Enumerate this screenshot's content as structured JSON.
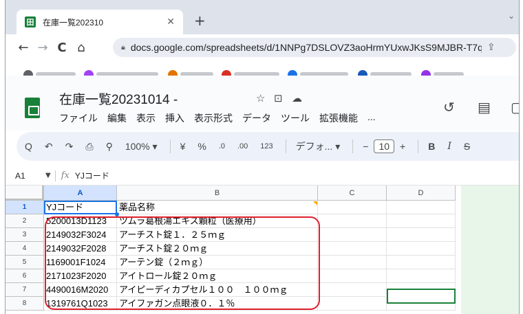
{
  "browser": {
    "tab_title": "在庫一覧202310",
    "tab_favicon_letter": "田",
    "tab_close": "✕",
    "new_tab": "+",
    "url": "docs.google.com/spreadsheets/d/1NNPg7DSLOVZ3aoHrmYUxwJKsS9MJBR-T7q...",
    "nav": {
      "back": "←",
      "forward": "→",
      "reload": "C",
      "home": "⌂"
    }
  },
  "doc": {
    "title": "在庫一覧20231014 -",
    "star_icon": "☆",
    "move_icon": "⊡",
    "cloud_icon": "☁",
    "menu": [
      "ファイル",
      "編集",
      "表示",
      "挿入",
      "表示形式",
      "データ",
      "ツール",
      "拡張機能",
      "..."
    ],
    "history_icon": "↺",
    "comment_icon": "▤"
  },
  "format_toolbar": {
    "search": "Q",
    "undo": "↶",
    "redo": "↷",
    "print": "⎙",
    "paint": "⚲",
    "zoom": "100%",
    "zoom_arrow": "▾",
    "currency": "¥",
    "percent": "%",
    "dec_decrease": ".0",
    "dec_increase": ".00",
    "number_format": "123",
    "font": "デフォ...",
    "font_arrow": "▾",
    "minus": "−",
    "font_size": "10",
    "plus": "+",
    "bold": "B",
    "italic": "I",
    "strike": "S"
  },
  "formula_bar": {
    "name_box": "A1",
    "fx": "fx",
    "content": "YJコード"
  },
  "grid": {
    "columns": [
      "A",
      "B",
      "C",
      "D"
    ],
    "rows": [
      {
        "num": "1",
        "a": "YJコード",
        "b": "薬品名称"
      },
      {
        "num": "2",
        "a": "5200013D1123",
        "b": "ツムラ葛根湯エキス顆粒（医療用）"
      },
      {
        "num": "3",
        "a": "2149032F3024",
        "b": "アーチスト錠１．２５ｍｇ"
      },
      {
        "num": "4",
        "a": "2149032F2028",
        "b": "アーチスト錠２０ｍｇ"
      },
      {
        "num": "5",
        "a": "1169001F1024",
        "b": "アーテン錠（２ｍｇ）"
      },
      {
        "num": "6",
        "a": "2171023F2020",
        "b": "アイトロール錠２０ｍｇ"
      },
      {
        "num": "7",
        "a": "4490016M2020",
        "b": "アイピーディカプセル１００　１００ｍｇ"
      },
      {
        "num": "8",
        "a": "1319761Q1023",
        "b": "アイファガン点眼液０．１％"
      }
    ]
  },
  "colors": {
    "sheets_green": "#188038",
    "selection_blue": "#1a73e8",
    "annotation_red": "#e01e2d"
  }
}
